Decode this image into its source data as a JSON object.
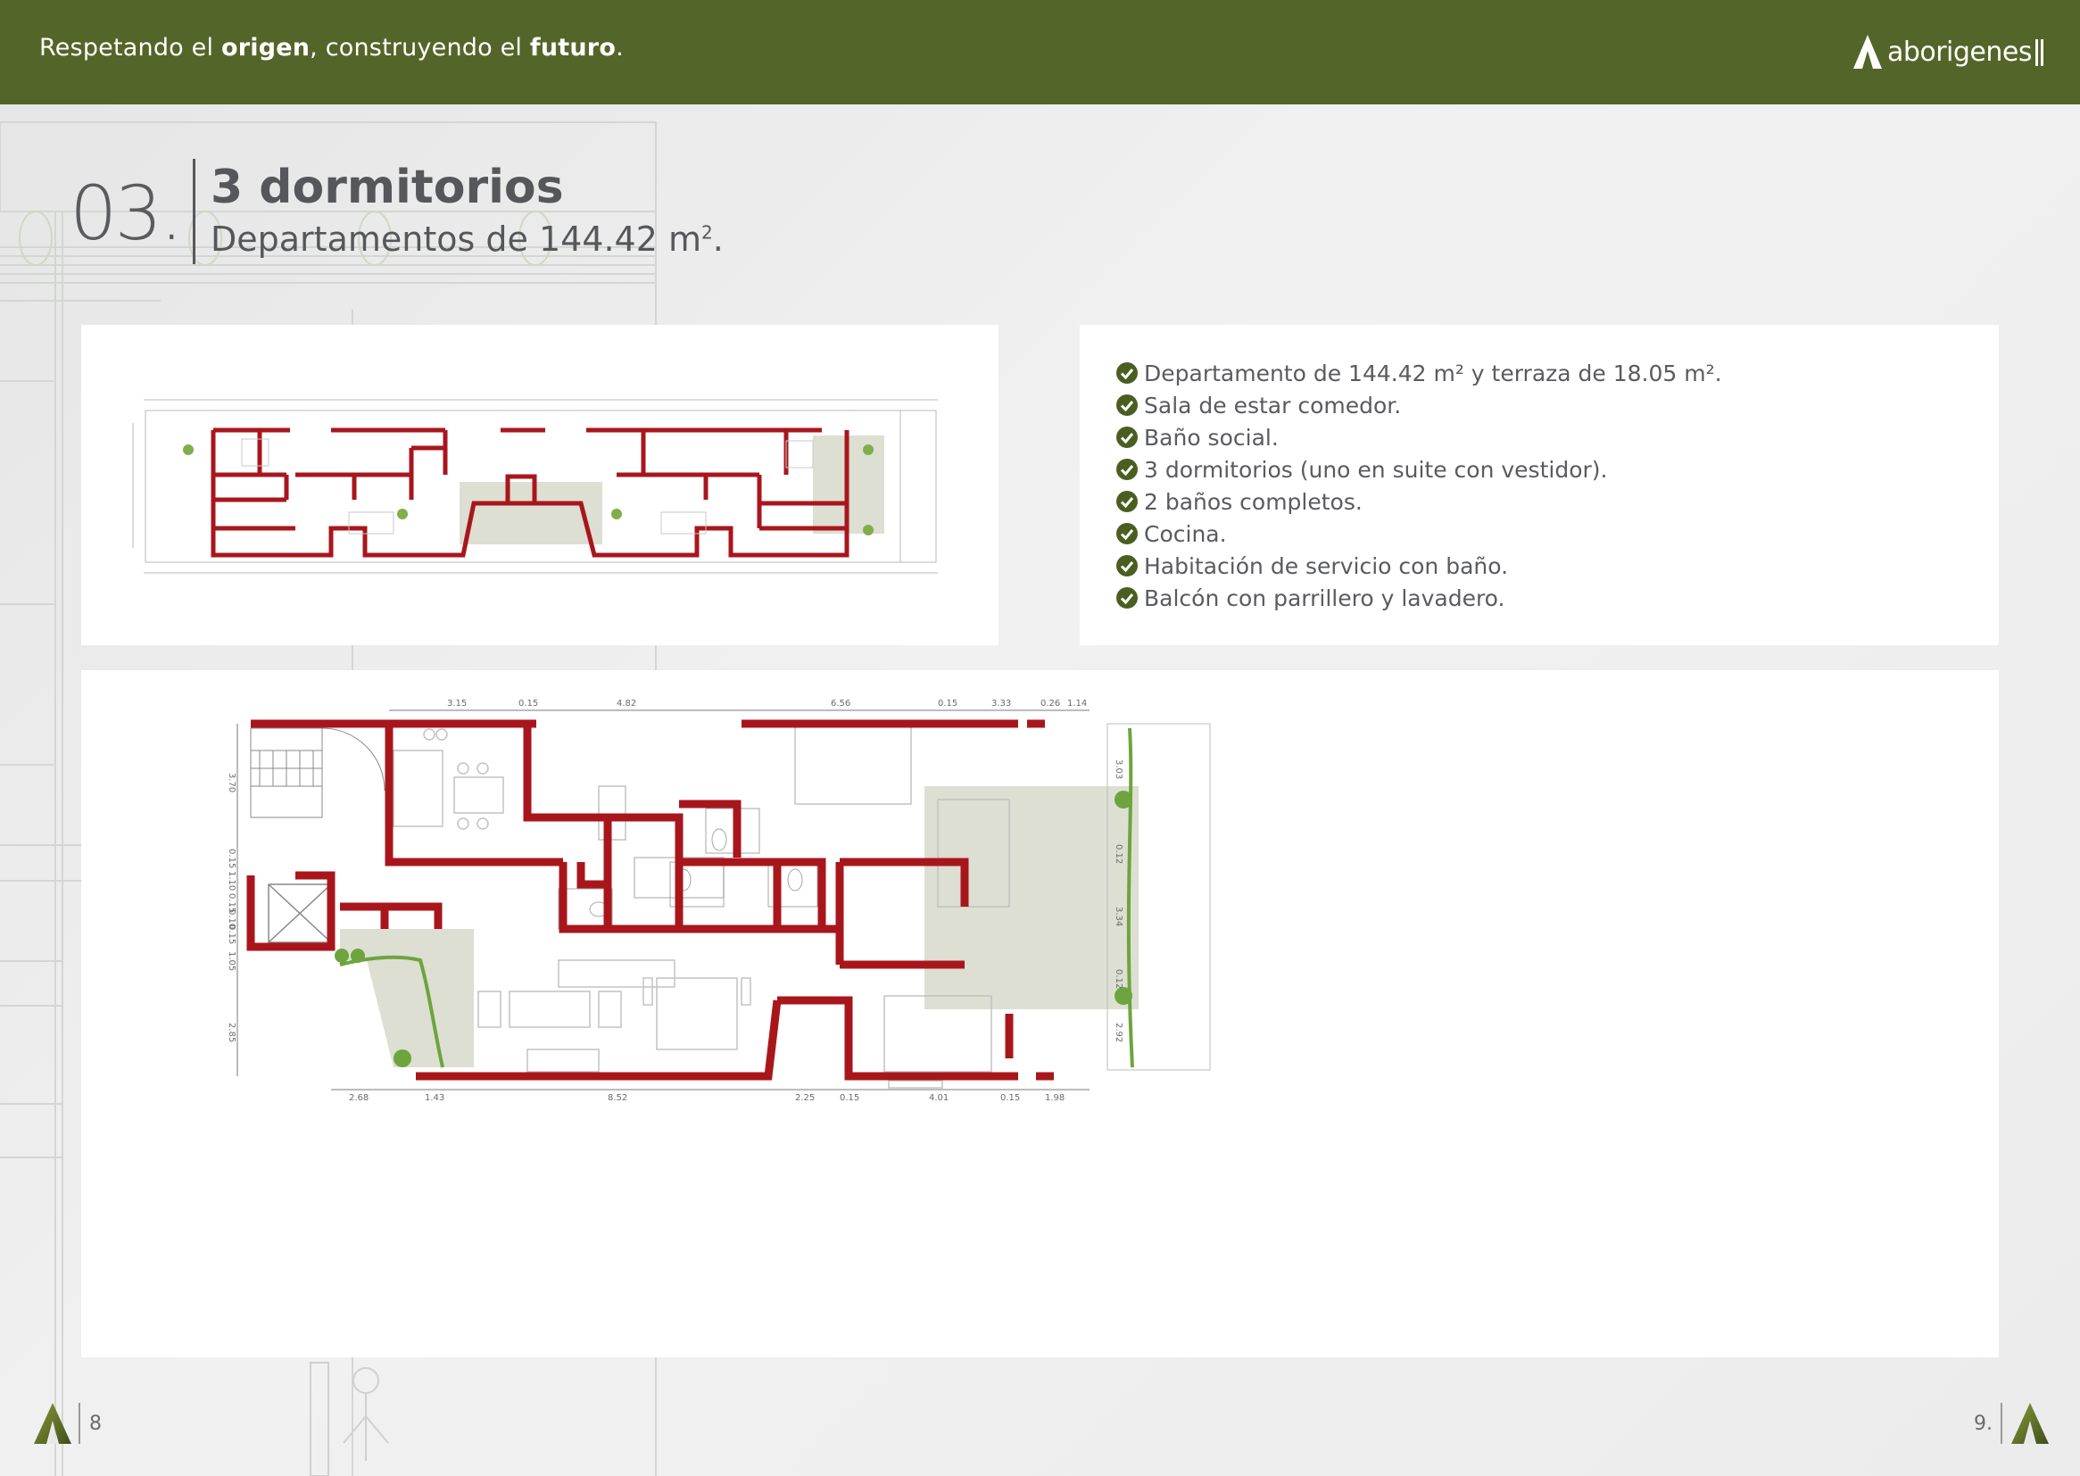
{
  "header": {
    "tagline_part1": "Respetando el ",
    "tagline_bold1": "origen",
    "tagline_part2": ", construyendo el ",
    "tagline_bold2": "futuro",
    "tagline_part3": ".",
    "brand": "aborigenes"
  },
  "section": {
    "number": "03.",
    "title": "3 dormitorios",
    "subtitle": "Departamentos de 144.42 m",
    "subtitle_sup": "2",
    "subtitle_end": "."
  },
  "features": [
    "Departamento de 144.42 m² y terraza de 18.05 m².",
    "Sala de estar comedor.",
    "Baño social.",
    "3 dormitorios (uno en suite con vestidor).",
    "2 baños completos.",
    "Cocina.",
    "Habitación de servicio con baño.",
    "Balcón con parrillero y lavadero."
  ],
  "plan_large": {
    "dims_top": [
      "3.15",
      "0.15",
      "4.82",
      "6.56",
      "0.15",
      "3.33",
      "0.26",
      "1.14"
    ],
    "dims_bottom": [
      "2.68",
      "1.43",
      "8.52",
      "2.25",
      "0.15",
      "4.01",
      "0.15",
      "1.98"
    ],
    "dims_left": [
      "3.70",
      "0.15",
      "1.10",
      "0.15",
      "0.10",
      "0.15",
      "1.05",
      "2.85"
    ],
    "dims_right": [
      "3.03",
      "0.12",
      "3.34",
      "0.12",
      "2.92"
    ]
  },
  "footer": {
    "page_left": "8",
    "page_right": "9."
  },
  "colors": {
    "header_bg": "#546529",
    "wall": "#a8161c",
    "terrace": "#dcdfd2",
    "check": "#4a5e21"
  }
}
